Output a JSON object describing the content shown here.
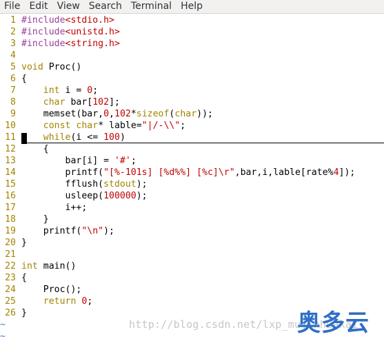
{
  "menu": {
    "items": [
      "File",
      "Edit",
      "View",
      "Search",
      "Terminal",
      "Help"
    ]
  },
  "colors": {
    "preproc": "#9a3f9a",
    "string": "#c00000",
    "keyword": "#a08400",
    "number": "#c00000",
    "linenumber": "#a08400",
    "tilde": "#3b7ad0"
  },
  "code": {
    "lines": [
      {
        "n": "1",
        "segs": [
          [
            "#include",
            "preproc"
          ],
          [
            "<stdio.h>",
            "string"
          ]
        ]
      },
      {
        "n": "2",
        "segs": [
          [
            "#include",
            "preproc"
          ],
          [
            "<unistd.h>",
            "string"
          ]
        ]
      },
      {
        "n": "3",
        "segs": [
          [
            "#include",
            "preproc"
          ],
          [
            "<string.h>",
            "string"
          ]
        ]
      },
      {
        "n": "4",
        "segs": []
      },
      {
        "n": "5",
        "segs": [
          [
            "void",
            "keyword"
          ],
          [
            " Proc()",
            "plain"
          ]
        ]
      },
      {
        "n": "6",
        "segs": [
          [
            "{",
            "plain"
          ]
        ]
      },
      {
        "n": "7",
        "segs": [
          [
            "    ",
            "plain"
          ],
          [
            "int",
            "keyword"
          ],
          [
            " i = ",
            "plain"
          ],
          [
            "0",
            "number"
          ],
          [
            ";",
            "plain"
          ]
        ]
      },
      {
        "n": "8",
        "segs": [
          [
            "    ",
            "plain"
          ],
          [
            "char",
            "keyword"
          ],
          [
            " bar[",
            "plain"
          ],
          [
            "102",
            "number"
          ],
          [
            "];",
            "plain"
          ]
        ]
      },
      {
        "n": "9",
        "segs": [
          [
            "    memset(bar,",
            "plain"
          ],
          [
            "0",
            "number"
          ],
          [
            ",",
            "plain"
          ],
          [
            "102",
            "number"
          ],
          [
            "*",
            "plain"
          ],
          [
            "sizeof",
            "keyword"
          ],
          [
            "(",
            "plain"
          ],
          [
            "char",
            "keyword"
          ],
          [
            "));",
            "plain"
          ]
        ]
      },
      {
        "n": "10",
        "segs": [
          [
            "    ",
            "plain"
          ],
          [
            "const",
            "keyword"
          ],
          [
            " ",
            "plain"
          ],
          [
            "char",
            "keyword"
          ],
          [
            "* lable=",
            "plain"
          ],
          [
            "\"|/-\\\\\"",
            "string"
          ],
          [
            ";",
            "plain"
          ]
        ]
      },
      {
        "n": "11",
        "segs": [
          [
            "    ",
            "plain"
          ],
          [
            "while",
            "keyword"
          ],
          [
            "(i <= ",
            "plain"
          ],
          [
            "100",
            "number"
          ],
          [
            ")",
            "plain"
          ]
        ]
      },
      {
        "n": "12",
        "segs": [
          [
            "    {",
            "plain"
          ]
        ]
      },
      {
        "n": "13",
        "segs": [
          [
            "        bar[i] = ",
            "plain"
          ],
          [
            "'#'",
            "string"
          ],
          [
            ";",
            "plain"
          ]
        ]
      },
      {
        "n": "14",
        "segs": [
          [
            "        printf(",
            "plain"
          ],
          [
            "\"[%-101s] [%d%%] [%c]\\r\"",
            "string"
          ],
          [
            ",bar,i,lable[rate%",
            "plain"
          ],
          [
            "4",
            "number"
          ],
          [
            "]);",
            "plain"
          ]
        ]
      },
      {
        "n": "15",
        "segs": [
          [
            "        fflush(",
            "plain"
          ],
          [
            "stdout",
            "keyword"
          ],
          [
            ");",
            "plain"
          ]
        ]
      },
      {
        "n": "16",
        "segs": [
          [
            "        usleep(",
            "plain"
          ],
          [
            "100000",
            "number"
          ],
          [
            ");",
            "plain"
          ]
        ]
      },
      {
        "n": "17",
        "segs": [
          [
            "        i++;",
            "plain"
          ]
        ]
      },
      {
        "n": "18",
        "segs": [
          [
            "    }",
            "plain"
          ]
        ]
      },
      {
        "n": "19",
        "segs": [
          [
            "    printf(",
            "plain"
          ],
          [
            "\"\\n\"",
            "string"
          ],
          [
            ");",
            "plain"
          ]
        ]
      },
      {
        "n": "20",
        "segs": [
          [
            "}",
            "plain"
          ]
        ]
      },
      {
        "n": "21",
        "segs": []
      },
      {
        "n": "22",
        "segs": [
          [
            "int",
            "keyword"
          ],
          [
            " main()",
            "plain"
          ]
        ]
      },
      {
        "n": "23",
        "segs": [
          [
            "{",
            "plain"
          ]
        ]
      },
      {
        "n": "24",
        "segs": [
          [
            "    Proc();",
            "plain"
          ]
        ]
      },
      {
        "n": "25",
        "segs": [
          [
            "    ",
            "plain"
          ],
          [
            "return",
            "keyword"
          ],
          [
            " ",
            "plain"
          ],
          [
            "0",
            "number"
          ],
          [
            ";",
            "plain"
          ]
        ]
      },
      {
        "n": "26",
        "segs": [
          [
            "}",
            "plain"
          ]
        ]
      }
    ],
    "tildes": [
      "~",
      "~"
    ]
  },
  "watermark": {
    "url": "http://blog.csdn.net/lxp_mujinhuakai",
    "logo": "奥多云"
  }
}
